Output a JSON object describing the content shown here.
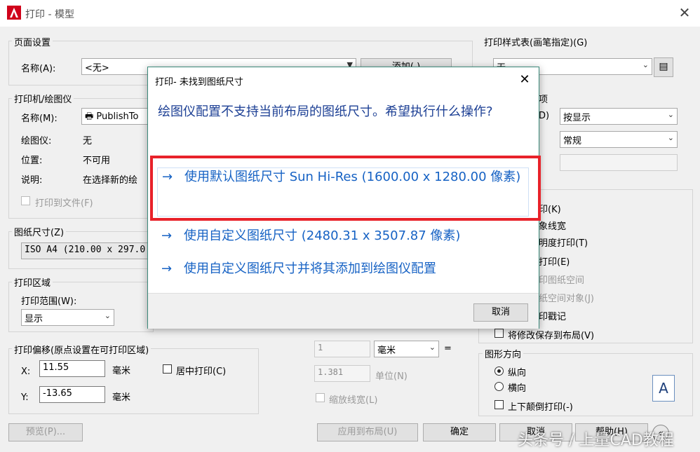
{
  "window": {
    "title": "打印 - 模型",
    "close_glyph": "✕"
  },
  "page_setup": {
    "group_label": "页面设置",
    "name_label": "名称(A):",
    "name_value": "<无>",
    "add_button": "添加(.)"
  },
  "printer": {
    "group_label": "打印机/绘图仪",
    "name_label": "名称(M):",
    "name_value": "PublishTo",
    "plotter_label": "绘图仪:",
    "plotter_value": "无",
    "location_label": "位置:",
    "location_value": "不可用",
    "desc_label": "说明:",
    "desc_value": "在选择新的绘",
    "print_to_file": "打印到文件(F)"
  },
  "paper_size": {
    "group_label": "图纸尺寸(Z)",
    "value": "ISO A4 (210.00 x 297.0"
  },
  "plot_area": {
    "group_label": "打印区域",
    "range_label": "打印范围(W):",
    "range_value": "显示"
  },
  "plot_offset": {
    "group_label": "打印偏移(原点设置在可打印区域)",
    "x_label": "X:",
    "x_value": "11.55",
    "x_unit": "毫米",
    "y_label": "Y:",
    "y_value": "-13.65",
    "y_unit": "毫米",
    "center_label": "居中打印(C)"
  },
  "scale": {
    "value1": "1",
    "unit_select": "毫米",
    "equals": "=",
    "value2": "1.381",
    "unit_label": "单位(N)",
    "scale_lineweights": "缩放线宽(L)"
  },
  "plot_style": {
    "group_label": "打印样式表(画笔指定)(G)",
    "value": "无",
    "options_label_fragment": "项",
    "shade_label_fragment": "D)",
    "shade_value": "按显示",
    "quality_value": "常规"
  },
  "plot_options": {
    "items": [
      "印(K)",
      "象线宽",
      "明度打印(T)",
      "打印(E)",
      "印图纸空间",
      "纸空间对象(J)",
      "印戳记"
    ],
    "save_changes": "将修改保存到布局(V)"
  },
  "orientation": {
    "group_label": "图形方向",
    "portrait": "纵向",
    "landscape": "横向",
    "upside_down": "上下颠倒打印(-)",
    "paper_icon_letter": "A"
  },
  "footer": {
    "preview": "预览(P)...",
    "apply_layout": "应用到布局(U)",
    "ok": "确定",
    "cancel": "取消",
    "help": "帮助(H)"
  },
  "dialog": {
    "title": "打印- 未找到图纸尺寸",
    "close_glyph": "✕",
    "instruction": "绘图仪配置不支持当前布局的图纸尺寸。希望执行什么操作?",
    "arrow_glyph": "→",
    "commands": [
      "使用默认图纸尺寸 Sun Hi-Res (1600.00 x 1280.00 像素)",
      "使用自定义图纸尺寸  (2480.31 x 3507.87 像素)",
      "使用自定义图纸尺寸并将其添加到绘图仪配置"
    ],
    "cancel": "取消"
  },
  "watermark": "头条号 / 上量CAD教程",
  "colors": {
    "highlight": "#e8222a",
    "command_link": "#1662c4",
    "instruction": "#1c3f94",
    "app_logo": "#d0021b"
  }
}
